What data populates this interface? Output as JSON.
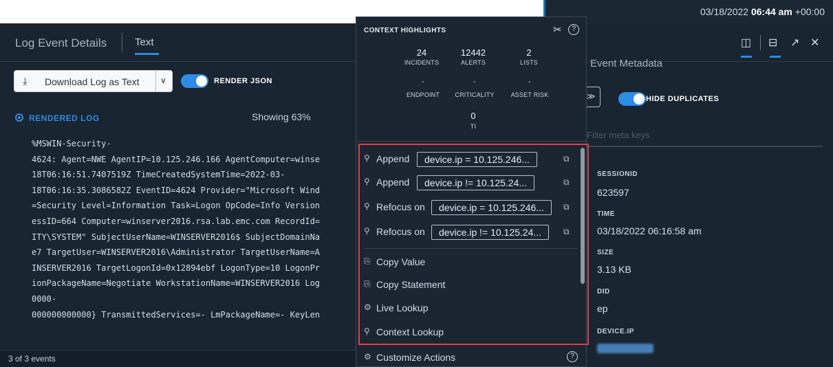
{
  "header": {
    "date": "03/18/2022",
    "time": "06:44 am",
    "tz": "+00:00"
  },
  "left_panel": {
    "title": "Log Event Details",
    "tab": "Text",
    "download_label": "Download Log as Text",
    "render_json_label": "RENDER JSON",
    "rendered_log_label": "RENDERED LOG",
    "showing": "Showing 63%",
    "log_lines": [
      "%MSWIN-Security-",
      "4624: Agent=NWE AgentIP=10.125.246.166 AgentComputer=winse",
      "18T06:16:51.7407519Z TimeCreatedSystemTime=2022-03-",
      "18T06:16:35.3086582Z EventID=4624 Provider=\"Microsoft Wind",
      "=Security Level=Information Task=Logon OpCode=Info Version",
      "essID=664 Computer=winserver2016.rsa.lab.emc.com RecordId=",
      "ITY\\SYSTEM\" SubjectUserName=WINSERVER2016$ SubjectDomainNa",
      "e7 TargetUser=WINSERVER2016\\Administrator TargetUserName=A",
      "INSERVER2016 TargetLogonId=0x12894ebf LogonType=10 LogonPr",
      "ionPackageName=Negotiate WorkstationName=WINSERVER2016 Log",
      "0000-",
      "000000000000} TransmittedServices=- LmPackageName=- KeyLen"
    ],
    "footer": "3 of 3 events"
  },
  "context_highlights": {
    "title": "CONTEXT HIGHLIGHTS",
    "stats": {
      "incidents": {
        "value": "24",
        "label": "INCIDENTS"
      },
      "alerts": {
        "value": "12442",
        "label": "ALERTS"
      },
      "lists": {
        "value": "2",
        "label": "LISTS"
      },
      "endpoint": {
        "value": "-",
        "label": "ENDPOINT"
      },
      "criticality": {
        "value": "-",
        "label": "CRITICALITY"
      },
      "asset_risk": {
        "value": "-",
        "label": "ASSET RISK"
      },
      "ti": {
        "value": "0",
        "label": "TI"
      }
    },
    "actions": [
      {
        "verb": "Append",
        "expr": "device.ip = 10.125.246..."
      },
      {
        "verb": "Append",
        "expr": "device.ip != 10.125.24..."
      },
      {
        "verb": "Refocus on",
        "expr": "device.ip = 10.125.246..."
      },
      {
        "verb": "Refocus on",
        "expr": "device.ip != 10.125.24..."
      }
    ],
    "copy_value": "Copy Value",
    "copy_statement": "Copy Statement",
    "live_lookup": "Live Lookup",
    "context_lookup": "Context Lookup",
    "customize": "Customize Actions",
    "highlight_color": "#d9424b"
  },
  "right_panel": {
    "title": "Event Metadata",
    "hide_duplicates_label": "HIDE DUPLICATES",
    "filter_placeholder": "Filter meta keys",
    "fields": [
      {
        "key": "SESSIONID",
        "value": "623597"
      },
      {
        "key": "TIME",
        "value": "03/18/2022 06:16:58 am"
      },
      {
        "key": "SIZE",
        "value": "3.13 KB"
      },
      {
        "key": "DID",
        "value": "ep"
      },
      {
        "key": "DEVICE.IP",
        "value": ""
      }
    ]
  }
}
